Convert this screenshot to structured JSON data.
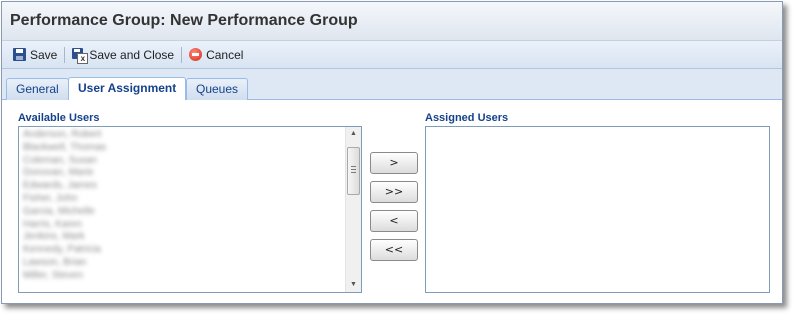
{
  "window": {
    "title": "Performance Group: New Performance Group"
  },
  "toolbar": {
    "save_label": "Save",
    "save_close_label": "Save and Close",
    "cancel_label": "Cancel"
  },
  "tabs": [
    {
      "label": "General",
      "active": false
    },
    {
      "label": "User Assignment",
      "active": true
    },
    {
      "label": "Queues",
      "active": false
    }
  ],
  "available_users": {
    "label": "Available Users",
    "items": [
      "Anderson, Robert",
      "Blackwell, Thomas",
      "Coleman, Susan",
      "Donovan, Marie",
      "Edwards, James",
      "Fisher, John",
      "Garcia, Michelle",
      "Harris, Karen",
      "Jenkins, Mark",
      "Kennedy, Patricia",
      "Lawson, Brian",
      "Miller, Steven"
    ]
  },
  "assigned_users": {
    "label": "Assigned Users",
    "items": []
  },
  "move_buttons": {
    "add": ">",
    "add_all": ">>",
    "remove": "<",
    "remove_all": "<<"
  },
  "colors": {
    "label_blue": "#15428b",
    "toolbar_bg": "#d8e4f2",
    "border": "#7f9db9"
  },
  "icons": {
    "save": "floppy-disk-icon",
    "save_close": "floppy-disk-close-icon",
    "cancel": "cancel-circle-icon"
  }
}
